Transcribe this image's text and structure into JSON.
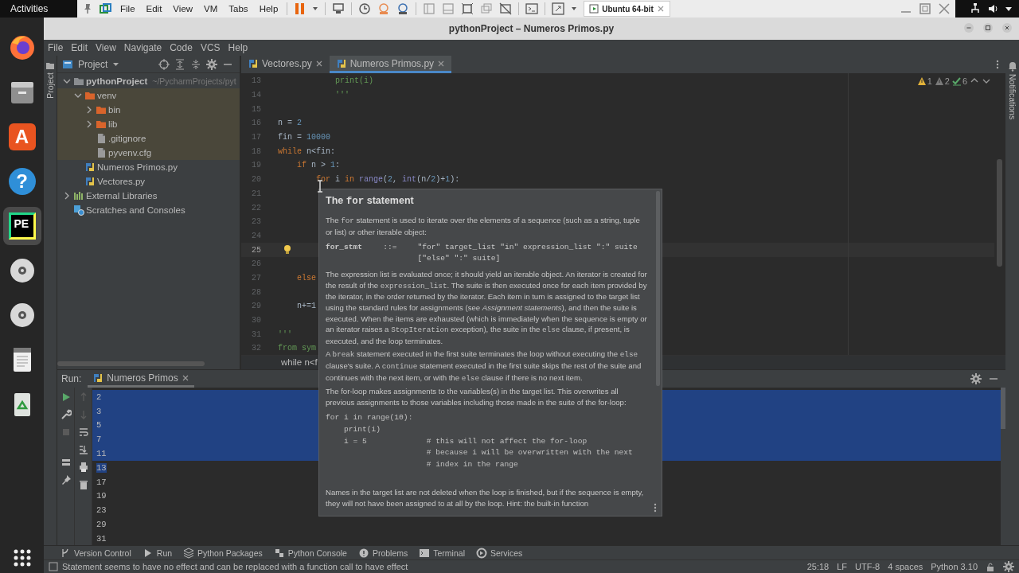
{
  "desktop_bar": {
    "activities": "Activities",
    "vm_menu": [
      "File",
      "Edit",
      "View",
      "VM",
      "Tabs",
      "Help"
    ],
    "vm_tab": "Ubuntu 64-bit"
  },
  "dock": {
    "items": [
      {
        "kind": "browser",
        "selected": false
      },
      {
        "kind": "files",
        "selected": false
      },
      {
        "kind": "store",
        "label": "A",
        "selected": false
      },
      {
        "kind": "help",
        "label": "?",
        "selected": false
      },
      {
        "kind": "ide",
        "label": "PE",
        "selected": true
      },
      {
        "kind": "disc",
        "selected": false
      },
      {
        "kind": "disc",
        "selected": false
      },
      {
        "kind": "editor",
        "selected": false
      },
      {
        "kind": "trash",
        "selected": false
      }
    ]
  },
  "window": {
    "title": "pythonProject – Numeros Primos.py"
  },
  "menu": [
    "File",
    "Edit",
    "View",
    "Navigate",
    "Code",
    "VCS",
    "Help"
  ],
  "project_panel": {
    "side_label": "Project",
    "title": "Project",
    "tree": [
      {
        "label": "pythonProject",
        "path": "~/PycharmProjects/pyt",
        "kind": "project",
        "expanded": true,
        "excluded": false,
        "children": [
          {
            "label": "venv",
            "kind": "folder",
            "expanded": true,
            "excluded": true,
            "children": [
              {
                "label": "bin",
                "kind": "folder",
                "expanded": false,
                "excluded": true
              },
              {
                "label": "lib",
                "kind": "folder",
                "expanded": false,
                "excluded": true
              },
              {
                "label": ".gitignore",
                "kind": "file",
                "excluded": true
              },
              {
                "label": "pyvenv.cfg",
                "kind": "file",
                "excluded": true
              }
            ]
          },
          {
            "label": "Numeros Primos.py",
            "kind": "python",
            "excluded": false
          },
          {
            "label": "Vectores.py",
            "kind": "python",
            "excluded": false
          }
        ]
      },
      {
        "label": "External Libraries",
        "kind": "library",
        "expanded": false,
        "excluded": false
      },
      {
        "label": "Scratches and Consoles",
        "kind": "scratch",
        "excluded": false
      }
    ]
  },
  "editor": {
    "tabs": [
      {
        "label": "Vectores.py",
        "selected": false
      },
      {
        "label": "Numeros Primos.py",
        "selected": true
      }
    ],
    "inspections": [
      {
        "kind": "warning",
        "count": "1"
      },
      {
        "kind": "weak_warning",
        "count": "2"
      },
      {
        "kind": "typo",
        "count": "6"
      }
    ],
    "lines": [
      {
        "number": "13",
        "current": false,
        "bulb": false,
        "tokens": [
          {
            "text": "            print(i)",
            "kind": "docstring"
          }
        ]
      },
      {
        "number": "14",
        "current": false,
        "bulb": false,
        "tokens": [
          {
            "text": "            '''",
            "kind": "docstring"
          }
        ]
      },
      {
        "number": "15",
        "current": false,
        "bulb": false
      },
      {
        "number": "16",
        "current": false,
        "bulb": false,
        "tokens": [
          {
            "text": "n = ",
            "kind": "plain"
          },
          {
            "text": "2",
            "kind": "number"
          }
        ]
      },
      {
        "number": "17",
        "current": false,
        "bulb": false,
        "tokens": [
          {
            "text": "fin = ",
            "kind": "plain"
          },
          {
            "text": "10000",
            "kind": "number"
          }
        ]
      },
      {
        "number": "18",
        "current": false,
        "bulb": false,
        "tokens": [
          {
            "text": "while",
            "kind": "keyword"
          },
          {
            "text": " n<fin:",
            "kind": "plain"
          }
        ]
      },
      {
        "number": "19",
        "current": false,
        "bulb": false,
        "tokens": [
          {
            "text": "    if",
            "kind": "keyword"
          },
          {
            "text": " n > ",
            "kind": "plain"
          },
          {
            "text": "1",
            "kind": "number"
          },
          {
            "text": ":",
            "kind": "plain"
          }
        ]
      },
      {
        "number": "20",
        "current": false,
        "bulb": false,
        "tokens": [
          {
            "text": "        for",
            "kind": "keyword"
          },
          {
            "text": " i ",
            "kind": "plain"
          },
          {
            "text": "in",
            "kind": "keyword"
          },
          {
            "text": " range",
            "kind": "builtin"
          },
          {
            "text": "(",
            "kind": "plain"
          },
          {
            "text": "2",
            "kind": "number"
          },
          {
            "text": ", ",
            "kind": "plain"
          },
          {
            "text": "int",
            "kind": "builtin"
          },
          {
            "text": "(n/",
            "kind": "plain"
          },
          {
            "text": "2",
            "kind": "number"
          },
          {
            "text": ")+",
            "kind": "plain"
          },
          {
            "text": "1",
            "kind": "number"
          },
          {
            "text": "):",
            "kind": "plain"
          }
        ]
      },
      {
        "number": "21",
        "current": false,
        "bulb": false
      },
      {
        "number": "22",
        "current": false,
        "bulb": false
      },
      {
        "number": "23",
        "current": false,
        "bulb": false
      },
      {
        "number": "24",
        "current": false,
        "bulb": false
      },
      {
        "number": "25",
        "current": true,
        "bulb": true
      },
      {
        "number": "26",
        "current": false,
        "bulb": false
      },
      {
        "number": "27",
        "current": false,
        "bulb": false,
        "tokens": [
          {
            "text": "    else",
            "kind": "keyword"
          }
        ]
      },
      {
        "number": "28",
        "current": false,
        "bulb": false
      },
      {
        "number": "29",
        "current": false,
        "bulb": false,
        "tokens": [
          {
            "text": "    n+=1",
            "kind": "plain"
          }
        ]
      },
      {
        "number": "30",
        "current": false,
        "bulb": false
      },
      {
        "number": "31",
        "current": false,
        "bulb": false,
        "tokens": [
          {
            "text": "'''",
            "kind": "docstring"
          }
        ]
      },
      {
        "number": "32",
        "current": false,
        "bulb": false,
        "tokens": [
          {
            "text": "from sym",
            "kind": "docstring"
          }
        ]
      }
    ],
    "breadcrumb": "while n<f"
  },
  "doc_popup": {
    "title": [
      {
        "text": "The ",
        "kind": "text"
      },
      {
        "text": "for",
        "kind": "code"
      },
      {
        "text": " statement",
        "kind": "text"
      }
    ],
    "blocks": [
      {
        "kind": "paragraph",
        "segments": [
          {
            "text": "The ",
            "kind": "text"
          },
          {
            "text": "for",
            "kind": "code"
          },
          {
            "text": " statement is used to iterate over the elements of a sequence (such as a string, tuple or list) or other iterable object:",
            "kind": "text"
          }
        ]
      },
      {
        "kind": "grammar",
        "lhs": "for_stmt",
        "op": "::=",
        "rhs": [
          "\"for\" target_list \"in\" expression_list \":\" suite",
          "[\"else\" \":\" suite]"
        ]
      },
      {
        "kind": "paragraph",
        "segments": [
          {
            "text": "The expression list is evaluated once; it should yield an iterable object. An iterator is created for the result of the ",
            "kind": "text"
          },
          {
            "text": "expression_list",
            "kind": "code"
          },
          {
            "text": ". The suite is then executed once for each item provided by the iterator, in the order returned by the iterator. Each item in turn is assigned to the target list using the standard rules for assignments (see ",
            "kind": "text"
          },
          {
            "text": "Assignment statements",
            "kind": "em"
          },
          {
            "text": "), and then the suite is executed. When the items are exhausted (which is immediately when the sequence is empty or an iterator raises a ",
            "kind": "text"
          },
          {
            "text": "StopIteration",
            "kind": "code"
          },
          {
            "text": " exception), the suite in the ",
            "kind": "text"
          },
          {
            "text": "else",
            "kind": "code"
          },
          {
            "text": " clause, if present, is executed, and the loop terminates.",
            "kind": "text"
          }
        ]
      },
      {
        "kind": "paragraph",
        "segments": [
          {
            "text": "A ",
            "kind": "text"
          },
          {
            "text": "break",
            "kind": "code"
          },
          {
            "text": " statement executed in the first suite terminates the loop without executing the ",
            "kind": "text"
          },
          {
            "text": "else",
            "kind": "code"
          },
          {
            "text": " clause's suite. A ",
            "kind": "text"
          },
          {
            "text": "continue",
            "kind": "code"
          },
          {
            "text": " statement executed in the first suite skips the rest of the suite and continues with the next item, or with the ",
            "kind": "text"
          },
          {
            "text": "else",
            "kind": "code"
          },
          {
            "text": " clause if there is no next item.",
            "kind": "text"
          }
        ]
      },
      {
        "kind": "paragraph",
        "segments": [
          {
            "text": "The for-loop makes assignments to the variables(s) in the target list. This overwrites all previous assignments to those variables including those made in the suite of the for-loop:",
            "kind": "text"
          }
        ]
      },
      {
        "kind": "code",
        "lines": [
          "for i in range(10):",
          "    print(i)",
          "    i = 5             # this will not affect the for-loop",
          "                      # because i will be overwritten with the next",
          "                      # index in the range"
        ]
      },
      {
        "kind": "paragraph",
        "segments": [
          {
            "text": "Names in the target list are not deleted when the loop is finished, but if the sequence is empty, they will not have been assigned to at all by the loop. Hint: the built-in function",
            "kind": "text"
          }
        ]
      }
    ]
  },
  "run_panel": {
    "label": "Run:",
    "tab": "Numeros Primos",
    "output": [
      {
        "text": "2",
        "selected": true
      },
      {
        "text": "3",
        "selected": true
      },
      {
        "text": "5",
        "selected": true
      },
      {
        "text": "7",
        "selected": true
      },
      {
        "text": "11",
        "selected": true
      },
      {
        "text": "13",
        "selected": true
      },
      {
        "text": "17",
        "selected": false
      },
      {
        "text": "19",
        "selected": false
      },
      {
        "text": "23",
        "selected": false
      },
      {
        "text": "29",
        "selected": false
      },
      {
        "text": "31",
        "selected": false
      }
    ]
  },
  "notifications_label": "Notifications",
  "tool_windows": [
    {
      "label": "Version Control",
      "kind": "vcs"
    },
    {
      "label": "Run",
      "kind": "run"
    },
    {
      "label": "Python Packages",
      "kind": "packages"
    },
    {
      "label": "Python Console",
      "kind": "console"
    },
    {
      "label": "Problems",
      "kind": "problems"
    },
    {
      "label": "Terminal",
      "kind": "terminal"
    },
    {
      "label": "Services",
      "kind": "services"
    }
  ],
  "status_bar": {
    "message": "Statement seems to have no effect and can be replaced with a function call to have effect",
    "items": [
      "25:18",
      "LF",
      "UTF-8",
      "4 spaces",
      "Python 3.10"
    ]
  }
}
